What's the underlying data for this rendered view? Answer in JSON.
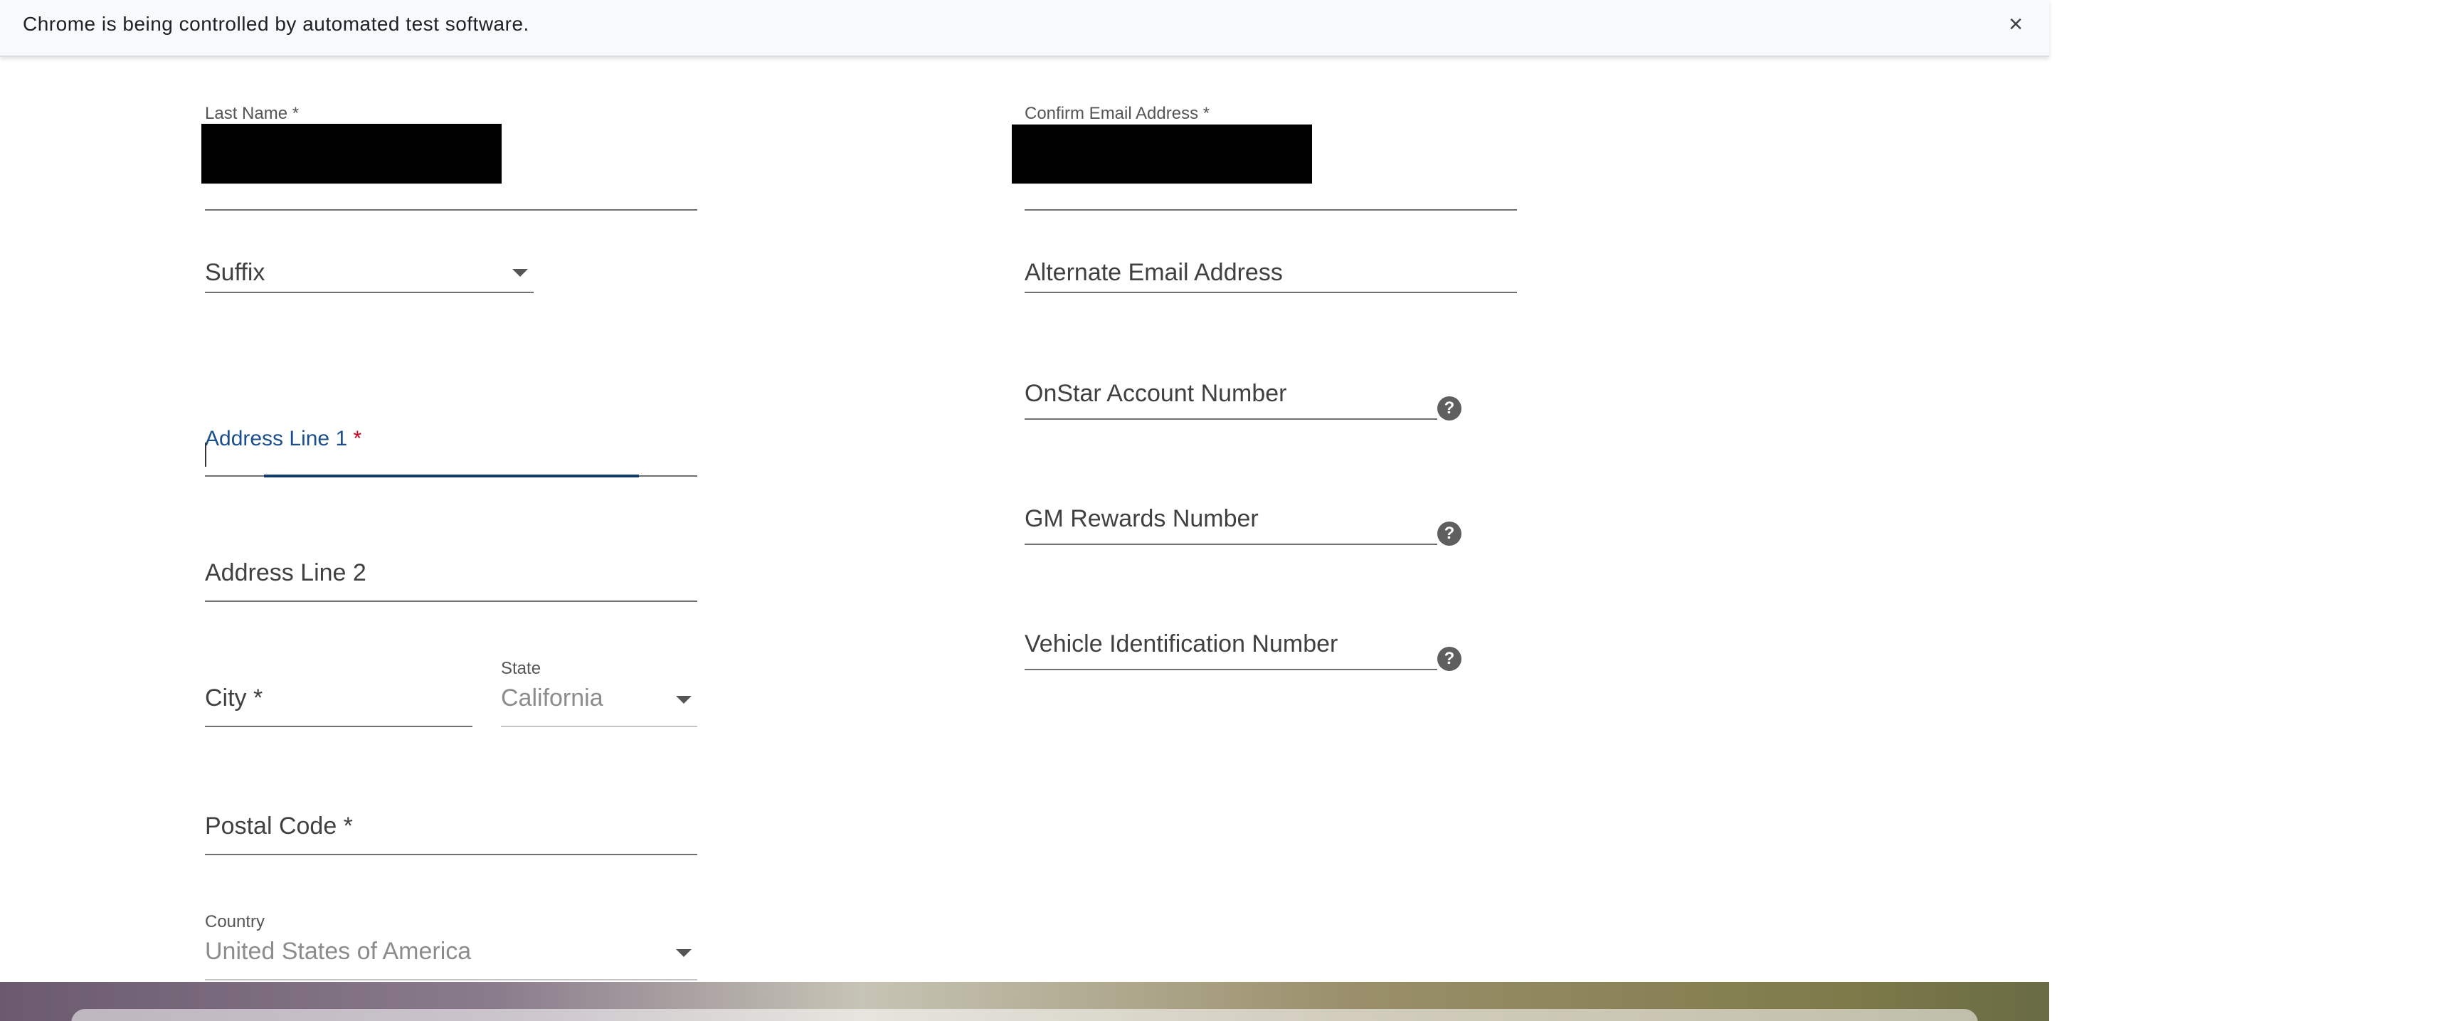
{
  "infobar": {
    "message": "Chrome is being controlled by automated test software.",
    "close_icon": "close-icon",
    "close_glyph": "×"
  },
  "form": {
    "last_name": {
      "label": "Last Name *"
    },
    "confirm_email": {
      "label": "Confirm Email Address *"
    },
    "suffix": {
      "label": "Suffix",
      "icon": "chevron-down-icon"
    },
    "alternate_email": {
      "label": "Alternate Email Address"
    },
    "address_line_1": {
      "label": "Address Line 1",
      "required_mark": "*"
    },
    "onstar_account": {
      "label": "OnStar Account Number",
      "help_glyph": "?",
      "icon": "help-icon"
    },
    "address_line_2": {
      "label": "Address Line 2"
    },
    "gm_rewards": {
      "label": "GM Rewards Number",
      "help_glyph": "?",
      "icon": "help-icon"
    },
    "city": {
      "label": "City *"
    },
    "state": {
      "label": "State",
      "value": "California",
      "icon": "chevron-down-icon"
    },
    "vin": {
      "label": "Vehicle Identification Number",
      "help_glyph": "?",
      "icon": "help-icon"
    },
    "postal_code": {
      "label": "Postal Code *"
    },
    "country": {
      "label": "Country",
      "value": "United States of America",
      "icon": "chevron-down-icon"
    }
  },
  "colors": {
    "accent": "#0d3b6e",
    "required": "#d0021b",
    "underline": "#6f6f6f"
  }
}
